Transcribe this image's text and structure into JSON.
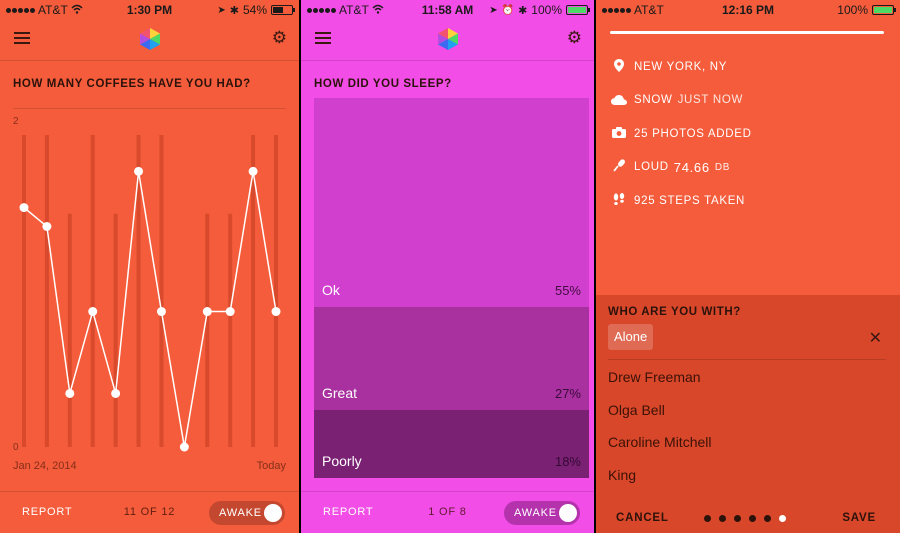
{
  "screen1": {
    "status": {
      "carrier": "AT&T",
      "time": "1:30 PM",
      "battery": "54%"
    },
    "question": "HOW MANY COFFEES HAVE YOU HAD?",
    "bottom": {
      "report": "REPORT",
      "page": "11 OF 12",
      "toggle": "AWAKE"
    }
  },
  "screen2": {
    "status": {
      "carrier": "AT&T",
      "time": "11:58 AM",
      "battery": "100%"
    },
    "question": "HOW DID YOU SLEEP?",
    "bottom": {
      "report": "REPORT",
      "page": "1 OF 8",
      "toggle": "AWAKE"
    }
  },
  "screen3": {
    "status": {
      "carrier": "AT&T",
      "time": "12:16 PM",
      "battery": "100%"
    },
    "location": "NEW YORK, NY",
    "weather": {
      "prefix": "SNOW",
      "suffix": "JUST NOW"
    },
    "photos": "25 PHOTOS ADDED",
    "sound": {
      "prefix": "LOUD",
      "value": "74.66",
      "unit": "DB"
    },
    "steps": "925 STEPS TAKEN",
    "who": {
      "title": "WHO ARE YOU WITH?",
      "selected": "Alone",
      "people": [
        "Drew Freeman",
        "Olga Bell",
        "Caroline Mitchell",
        "King"
      ]
    },
    "bottom": {
      "cancel": "CANCEL",
      "save": "SAVE",
      "page_count": 6,
      "active_page": 6
    }
  },
  "icons": [
    "list-menu-icon",
    "hexagon-logo-icon",
    "gear-icon",
    "location-pin-icon",
    "cloud-icon",
    "camera-icon",
    "microphone-icon",
    "footsteps-icon",
    "close-icon",
    "wifi-icon",
    "bluetooth-icon"
  ],
  "colors": {
    "coral": "#f45c3b",
    "magenta": "#f24de6",
    "sleep_ok": "#d13fce",
    "sleep_great": "#a8309f",
    "sleep_poorly": "#7a2173"
  },
  "chart_data": [
    {
      "type": "line",
      "title": "HOW MANY COFFEES HAVE YOU HAD?",
      "xlabel": "",
      "ylabel": "",
      "x_start_label": "Jan 24, 2014",
      "x_end_label": "Today",
      "ylim": [
        0,
        2
      ],
      "y_ticks": [
        "2",
        "0"
      ],
      "series": [
        {
          "values": [
            1.52,
            1.4,
            0.34,
            0.86,
            0.34,
            1.75,
            0.86,
            0.0,
            0.86,
            0.86,
            1.75,
            0.86
          ]
        }
      ],
      "bars": [
        2,
        2,
        1.5,
        2,
        1.5,
        2,
        2,
        0,
        1.5,
        1.5,
        2,
        2
      ]
    },
    {
      "type": "bar",
      "title": "HOW DID YOU SLEEP?",
      "categories": [
        "Ok",
        "Great",
        "Poorly"
      ],
      "values": [
        55,
        27,
        18
      ],
      "value_labels": [
        "55%",
        "27%",
        "18%"
      ],
      "unit": "%"
    }
  ]
}
